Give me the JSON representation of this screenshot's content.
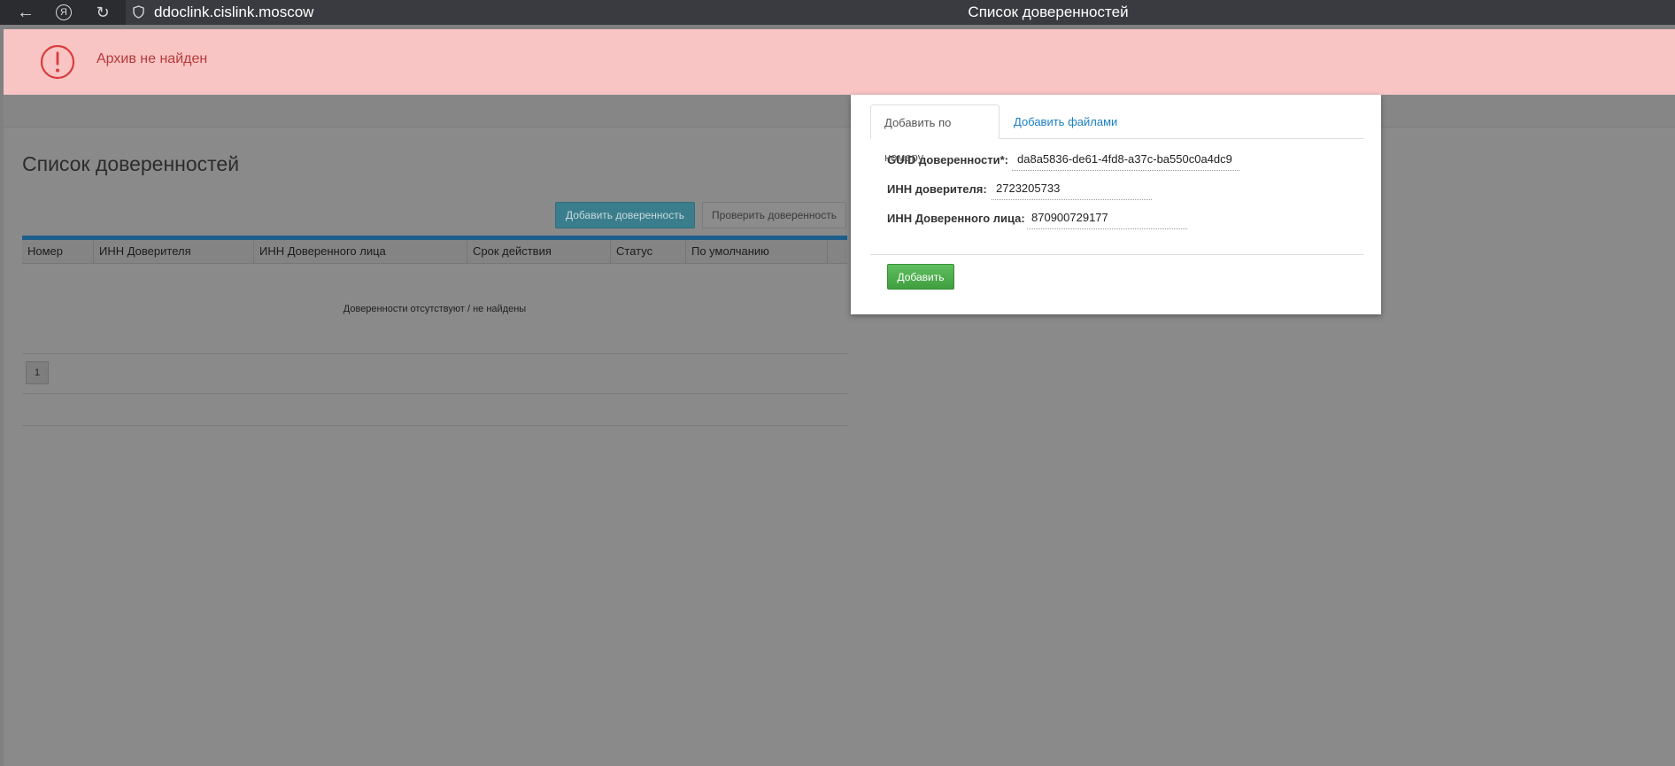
{
  "browser": {
    "url": "ddoclink.cislink.moscow",
    "title": "Список доверенностей",
    "icons": [
      "back-arrow-icon",
      "yandex-icon",
      "reload-icon",
      "shield-icon"
    ]
  },
  "alert": {
    "text": "Архив не найден",
    "icon": "exclamation-circle-icon",
    "color": "#b53a3a"
  },
  "main": {
    "heading": "Список доверенностей",
    "add_button": "Добавить доверенность",
    "check_button": "Проверить доверенность",
    "table": {
      "columns": [
        "Номер",
        "ИНН Доверителя",
        "ИНН Доверенного лица",
        "Срок действия",
        "Статус",
        "По умолчанию"
      ],
      "empty_message": "Доверенности отсутствуют / не найдены"
    },
    "pagination": {
      "current_page": "1"
    }
  },
  "modal": {
    "tabs": [
      "Добавить по номеру",
      "Добавить файлами"
    ],
    "fields": [
      {
        "label": "GUID доверенности*:",
        "value": "da8a5836-de61-4fd8-a37c-ba550c0a4dc9"
      },
      {
        "label": "ИНН доверителя:",
        "value": "2723205733"
      },
      {
        "label": "ИНН Доверенного лица:",
        "value": "870900729177"
      }
    ],
    "submit_label": "Добавить",
    "submit_color": "#4caf50"
  }
}
